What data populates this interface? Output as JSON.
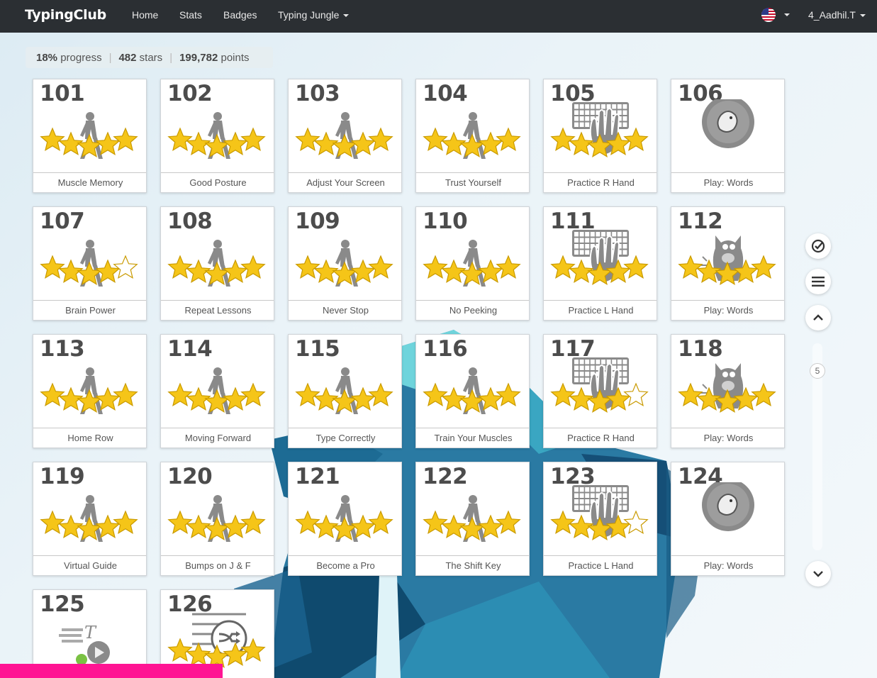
{
  "nav": {
    "brand": "TypingClub",
    "links": [
      "Home",
      "Stats",
      "Badges",
      "Typing Jungle"
    ],
    "user": "4_Aadhil.T",
    "language_icon": "us-flag-icon"
  },
  "stats": {
    "progress": "18%",
    "progress_label": "progress",
    "stars": "482",
    "stars_label": "stars",
    "points": "199,782",
    "points_label": "points"
  },
  "scroll": {
    "page": "5"
  },
  "lessons": [
    {
      "num": "101",
      "name": "Muscle Memory",
      "icon": "walker",
      "stars": 5
    },
    {
      "num": "102",
      "name": "Good Posture",
      "icon": "walker",
      "stars": 5
    },
    {
      "num": "103",
      "name": "Adjust Your Screen",
      "icon": "walker",
      "stars": 5
    },
    {
      "num": "104",
      "name": "Trust Yourself",
      "icon": "walker",
      "stars": 5
    },
    {
      "num": "105",
      "name": "Practice R Hand",
      "icon": "keyboard-hand",
      "stars": 5
    },
    {
      "num": "106",
      "name": "Play: Words",
      "icon": "game-ball",
      "stars": 0
    },
    {
      "num": "107",
      "name": "Brain Power",
      "icon": "walker",
      "stars": 4
    },
    {
      "num": "108",
      "name": "Repeat Lessons",
      "icon": "walker",
      "stars": 5
    },
    {
      "num": "109",
      "name": "Never Stop",
      "icon": "walker",
      "stars": 5
    },
    {
      "num": "110",
      "name": "No Peeking",
      "icon": "walker",
      "stars": 5
    },
    {
      "num": "111",
      "name": "Practice L Hand",
      "icon": "keyboard-hand",
      "stars": 5
    },
    {
      "num": "112",
      "name": "Play: Words",
      "icon": "monster",
      "stars": 5
    },
    {
      "num": "113",
      "name": "Home Row",
      "icon": "walker",
      "stars": 5
    },
    {
      "num": "114",
      "name": "Moving Forward",
      "icon": "walker",
      "stars": 5
    },
    {
      "num": "115",
      "name": "Type Correctly",
      "icon": "walker",
      "stars": 5
    },
    {
      "num": "116",
      "name": "Train Your Muscles",
      "icon": "walker",
      "stars": 5
    },
    {
      "num": "117",
      "name": "Practice R Hand",
      "icon": "keyboard-hand",
      "stars": 4
    },
    {
      "num": "118",
      "name": "Play: Words",
      "icon": "monster",
      "stars": 5
    },
    {
      "num": "119",
      "name": "Virtual Guide",
      "icon": "walker",
      "stars": 5
    },
    {
      "num": "120",
      "name": "Bumps on J & F",
      "icon": "walker",
      "stars": 5
    },
    {
      "num": "121",
      "name": "Become a Pro",
      "icon": "walker",
      "stars": 5
    },
    {
      "num": "122",
      "name": "The Shift Key",
      "icon": "walker",
      "stars": 5
    },
    {
      "num": "123",
      "name": "Practice L Hand",
      "icon": "keyboard-hand",
      "stars": 4
    },
    {
      "num": "124",
      "name": "Play: Words",
      "icon": "game-ball",
      "stars": 0
    },
    {
      "num": "125",
      "name": "",
      "icon": "video",
      "stars": 0
    },
    {
      "num": "126",
      "name": "",
      "icon": "shuffle",
      "stars": 5
    }
  ],
  "colors": {
    "navbar": "#2b2f33",
    "star_fill": "#f5c518",
    "icon_gray": "#8a8a8a",
    "accent_pink": "#ff1493"
  }
}
